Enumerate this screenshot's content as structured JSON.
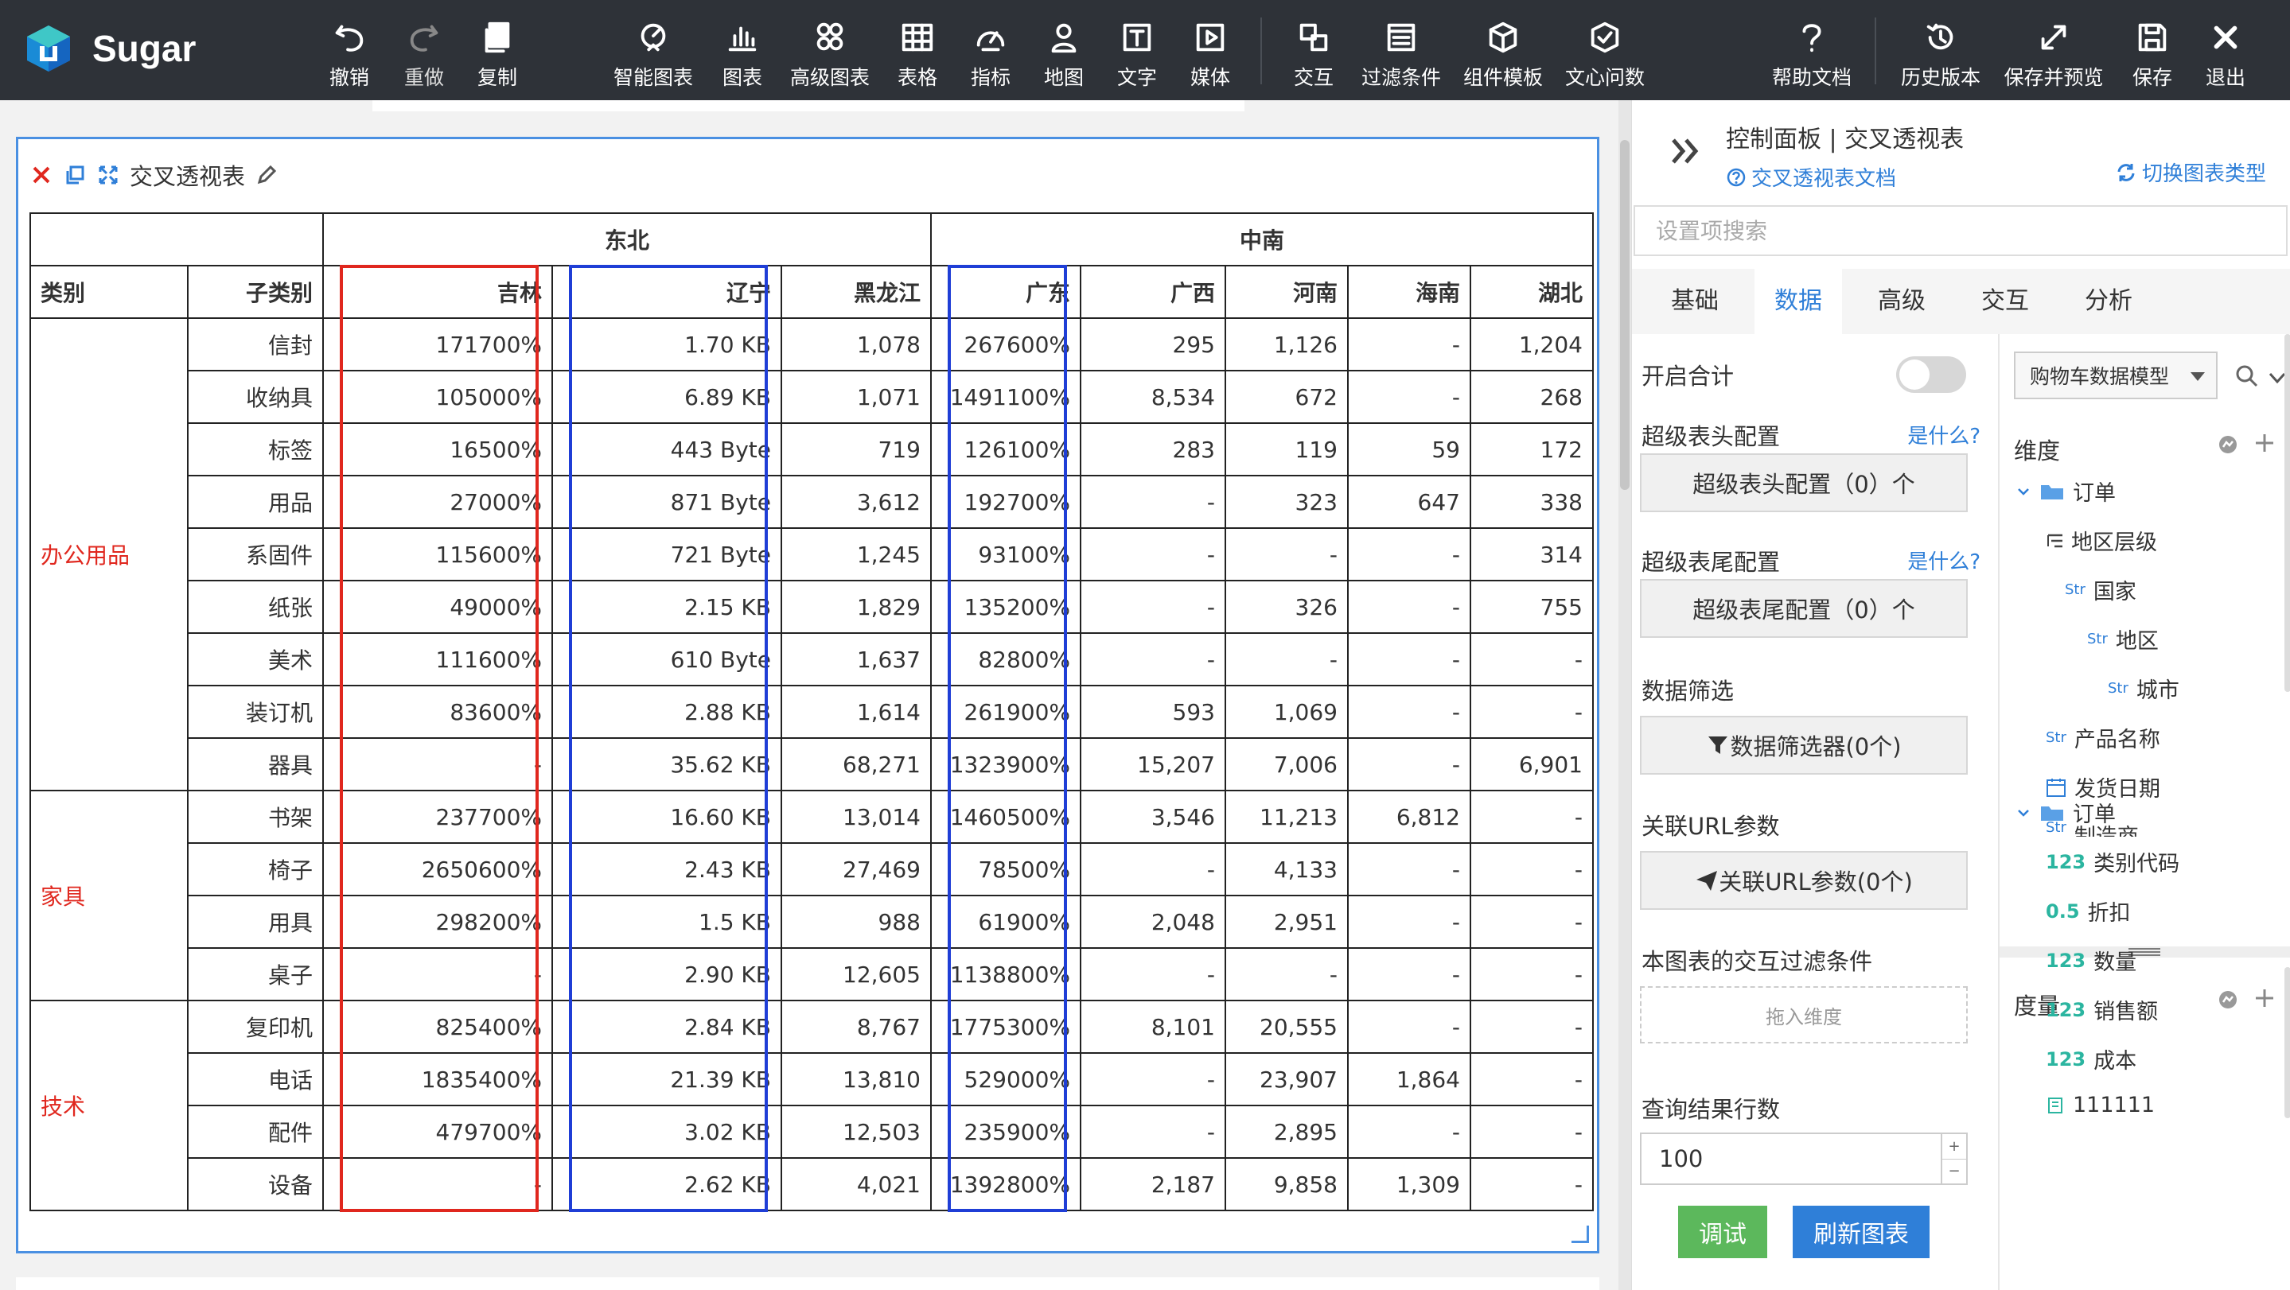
{
  "app": {
    "name": "Sugar"
  },
  "toolbar": {
    "undo": "撤销",
    "redo": "重做",
    "copy": "复制",
    "smart_chart": "智能图表",
    "chart": "图表",
    "advanced_chart": "高级图表",
    "table": "表格",
    "indicator": "指标",
    "map": "地图",
    "text": "文字",
    "media": "媒体",
    "interaction": "交互",
    "filter": "过滤条件",
    "component_template": "组件模板",
    "wenxin": "文心问数",
    "help": "帮助文档",
    "history": "历史版本",
    "save_preview": "保存并预览",
    "save": "保存",
    "exit": "退出"
  },
  "widget": {
    "title": "交叉透视表",
    "groups": [
      "东北",
      "中南"
    ],
    "headers": [
      "类别",
      "子类别",
      "吉林",
      "辽宁",
      "黑龙江",
      "广东",
      "广西",
      "河南",
      "海南",
      "湖北"
    ],
    "categories": [
      {
        "name": "办公用品",
        "rows": [
          [
            "信封",
            "171700%",
            "1.70 KB",
            "1,078",
            "267600%",
            "295",
            "1,126",
            "-",
            "1,204"
          ],
          [
            "收纳具",
            "105000%",
            "6.89 KB",
            "1,071",
            "1491100%",
            "8,534",
            "672",
            "-",
            "268"
          ],
          [
            "标签",
            "16500%",
            "443 Byte",
            "719",
            "126100%",
            "283",
            "119",
            "59",
            "172"
          ],
          [
            "用品",
            "27000%",
            "871 Byte",
            "3,612",
            "192700%",
            "-",
            "323",
            "647",
            "338"
          ],
          [
            "系固件",
            "115600%",
            "721 Byte",
            "1,245",
            "93100%",
            "-",
            "-",
            "-",
            "314"
          ],
          [
            "纸张",
            "49000%",
            "2.15 KB",
            "1,829",
            "135200%",
            "-",
            "326",
            "-",
            "755"
          ],
          [
            "美术",
            "111600%",
            "610 Byte",
            "1,637",
            "82800%",
            "-",
            "-",
            "-",
            "-"
          ],
          [
            "装订机",
            "83600%",
            "2.88 KB",
            "1,614",
            "261900%",
            "593",
            "1,069",
            "-",
            "-"
          ],
          [
            "器具",
            "-",
            "35.62 KB",
            "68,271",
            "1323900%",
            "15,207",
            "7,006",
            "-",
            "6,901"
          ]
        ]
      },
      {
        "name": "家具",
        "rows": [
          [
            "书架",
            "237700%",
            "16.60 KB",
            "13,014",
            "1460500%",
            "3,546",
            "11,213",
            "6,812",
            "-"
          ],
          [
            "椅子",
            "2650600%",
            "2.43 KB",
            "27,469",
            "78500%",
            "-",
            "4,133",
            "-",
            "-"
          ],
          [
            "用具",
            "298200%",
            "1.5 KB",
            "988",
            "61900%",
            "2,048",
            "2,951",
            "-",
            "-"
          ],
          [
            "桌子",
            "-",
            "2.90 KB",
            "12,605",
            "1138800%",
            "-",
            "-",
            "-",
            "-"
          ]
        ]
      },
      {
        "name": "技术",
        "rows": [
          [
            "复印机",
            "825400%",
            "2.84 KB",
            "8,767",
            "1775300%",
            "8,101",
            "20,555",
            "-",
            "-"
          ],
          [
            "电话",
            "1835400%",
            "21.39 KB",
            "13,810",
            "529000%",
            "-",
            "23,907",
            "1,864",
            "-"
          ],
          [
            "配件",
            "479700%",
            "3.02 KB",
            "12,503",
            "235900%",
            "-",
            "2,895",
            "-",
            "-"
          ],
          [
            "设备",
            "-",
            "2.62 KB",
            "4,021",
            "1392800%",
            "2,187",
            "9,858",
            "1,309",
            "-"
          ]
        ]
      }
    ]
  },
  "panel": {
    "title": "控制面板 | 交叉透视表",
    "doc_link": "交叉透视表文档",
    "switch_type": "切换图表类型",
    "search_placeholder": "设置项搜索",
    "tabs": [
      "基础",
      "数据",
      "高级",
      "交互",
      "分析"
    ],
    "active_tab": "数据",
    "enable_total": "开启合计",
    "super_header": "超级表头配置",
    "super_header_btn": "超级表头配置（0）个",
    "super_footer": "超级表尾配置",
    "super_footer_btn": "超级表尾配置（0）个",
    "what_is": "是什么?",
    "data_filter": "数据筛选",
    "data_filter_btn": "数据筛选器(0个)",
    "url_params": "关联URL参数",
    "url_params_btn": "关联URL参数(0个)",
    "interaction_filter": "本图表的交互过滤条件",
    "drop_dimension": "拖入维度",
    "query_rows": "查询结果行数",
    "query_rows_value": "100",
    "debug": "调试",
    "refresh": "刷新图表",
    "model": "购物车数据模型",
    "dimension": "维度",
    "measure": "度量",
    "dim_tree": {
      "order": "订单",
      "region_level": "地区层级",
      "country": "国家",
      "region": "地区",
      "city": "城市",
      "product": "产品名称",
      "ship_date": "发货日期",
      "maker": "制造商"
    },
    "measure_tree": {
      "order": "订单",
      "cat_code": "类别代码",
      "discount": "折扣",
      "quantity": "数量",
      "sales": "销售额",
      "cost": "成本",
      "field": "111111"
    },
    "type_str": "Str",
    "type_123": "123",
    "type_05": "0.5"
  },
  "colors": {
    "accent": "#2f7fd8",
    "category": "#e0271e",
    "highlight_red": "#e0271e",
    "highlight_blue": "#1f3ed6",
    "debug_btn": "#5cb85c",
    "refresh_btn": "#2f7fd8"
  }
}
